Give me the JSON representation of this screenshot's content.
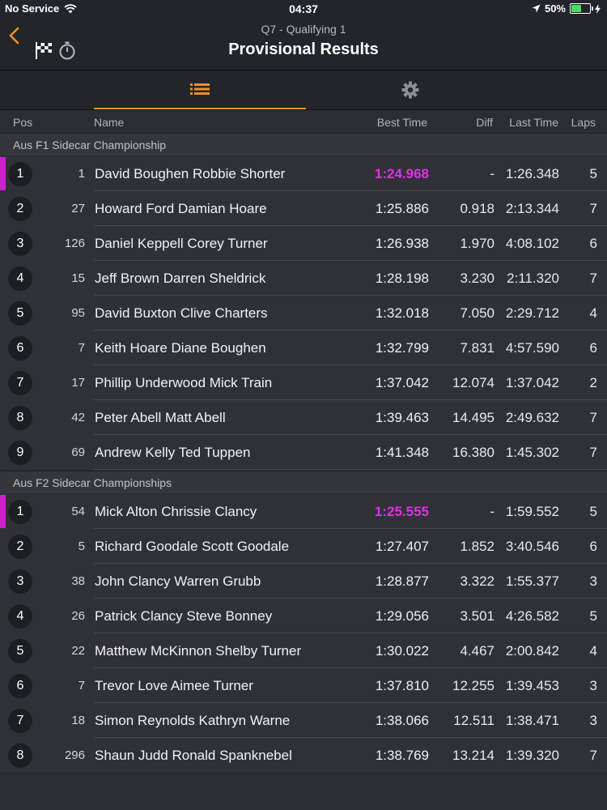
{
  "status": {
    "carrier": "No Service",
    "time": "04:37",
    "battery": "50%"
  },
  "header": {
    "subtitle": "Q7 - Qualifying 1",
    "title": "Provisional Results"
  },
  "columns": {
    "pos": "Pos",
    "name": "Name",
    "best": "Best Time",
    "diff": "Diff",
    "last": "Last Time",
    "laps": "Laps"
  },
  "colors": {
    "accent": "#f0921e",
    "fastest": "#e32fe3"
  },
  "groups": [
    {
      "title": "Aus F1 Sidecar Championship",
      "rows": [
        {
          "pos": "1",
          "num": "1",
          "name": "David Boughen Robbie Shorter",
          "best": "1:24.968",
          "diff": "-",
          "last": "1:26.348",
          "laps": "5",
          "fastest": true
        },
        {
          "pos": "2",
          "num": "27",
          "name": "Howard Ford Damian Hoare",
          "best": "1:25.886",
          "diff": "0.918",
          "last": "2:13.344",
          "laps": "7"
        },
        {
          "pos": "3",
          "num": "126",
          "name": "Daniel Keppell Corey Turner",
          "best": "1:26.938",
          "diff": "1.970",
          "last": "4:08.102",
          "laps": "6"
        },
        {
          "pos": "4",
          "num": "15",
          "name": "Jeff Brown Darren Sheldrick",
          "best": "1:28.198",
          "diff": "3.230",
          "last": "2:11.320",
          "laps": "7"
        },
        {
          "pos": "5",
          "num": "95",
          "name": "David Buxton Clive Charters",
          "best": "1:32.018",
          "diff": "7.050",
          "last": "2:29.712",
          "laps": "4"
        },
        {
          "pos": "6",
          "num": "7",
          "name": "Keith Hoare Diane Boughen",
          "best": "1:32.799",
          "diff": "7.831",
          "last": "4:57.590",
          "laps": "6"
        },
        {
          "pos": "7",
          "num": "17",
          "name": "Phillip Underwood Mick Train",
          "best": "1:37.042",
          "diff": "12.074",
          "last": "1:37.042",
          "laps": "2"
        },
        {
          "pos": "8",
          "num": "42",
          "name": "Peter Abell Matt Abell",
          "best": "1:39.463",
          "diff": "14.495",
          "last": "2:49.632",
          "laps": "7"
        },
        {
          "pos": "9",
          "num": "69",
          "name": "Andrew Kelly Ted Tuppen",
          "best": "1:41.348",
          "diff": "16.380",
          "last": "1:45.302",
          "laps": "7"
        }
      ]
    },
    {
      "title": "Aus F2 Sidecar Championships",
      "rows": [
        {
          "pos": "1",
          "num": "54",
          "name": "Mick Alton Chrissie Clancy",
          "best": "1:25.555",
          "diff": "-",
          "last": "1:59.552",
          "laps": "5",
          "fastest": true
        },
        {
          "pos": "2",
          "num": "5",
          "name": "Richard Goodale Scott Goodale",
          "best": "1:27.407",
          "diff": "1.852",
          "last": "3:40.546",
          "laps": "6"
        },
        {
          "pos": "3",
          "num": "38",
          "name": "John Clancy Warren Grubb",
          "best": "1:28.877",
          "diff": "3.322",
          "last": "1:55.377",
          "laps": "3"
        },
        {
          "pos": "4",
          "num": "26",
          "name": "Patrick Clancy Steve Bonney",
          "best": "1:29.056",
          "diff": "3.501",
          "last": "4:26.582",
          "laps": "5"
        },
        {
          "pos": "5",
          "num": "22",
          "name": "Matthew McKinnon Shelby Turner",
          "best": "1:30.022",
          "diff": "4.467",
          "last": "2:00.842",
          "laps": "4"
        },
        {
          "pos": "6",
          "num": "7",
          "name": "Trevor Love Aimee Turner",
          "best": "1:37.810",
          "diff": "12.255",
          "last": "1:39.453",
          "laps": "3"
        },
        {
          "pos": "7",
          "num": "18",
          "name": "Simon Reynolds Kathryn Warne",
          "best": "1:38.066",
          "diff": "12.511",
          "last": "1:38.471",
          "laps": "3"
        },
        {
          "pos": "8",
          "num": "296",
          "name": "Shaun Judd Ronald Spanknebel",
          "best": "1:38.769",
          "diff": "13.214",
          "last": "1:39.320",
          "laps": "7"
        }
      ]
    }
  ]
}
